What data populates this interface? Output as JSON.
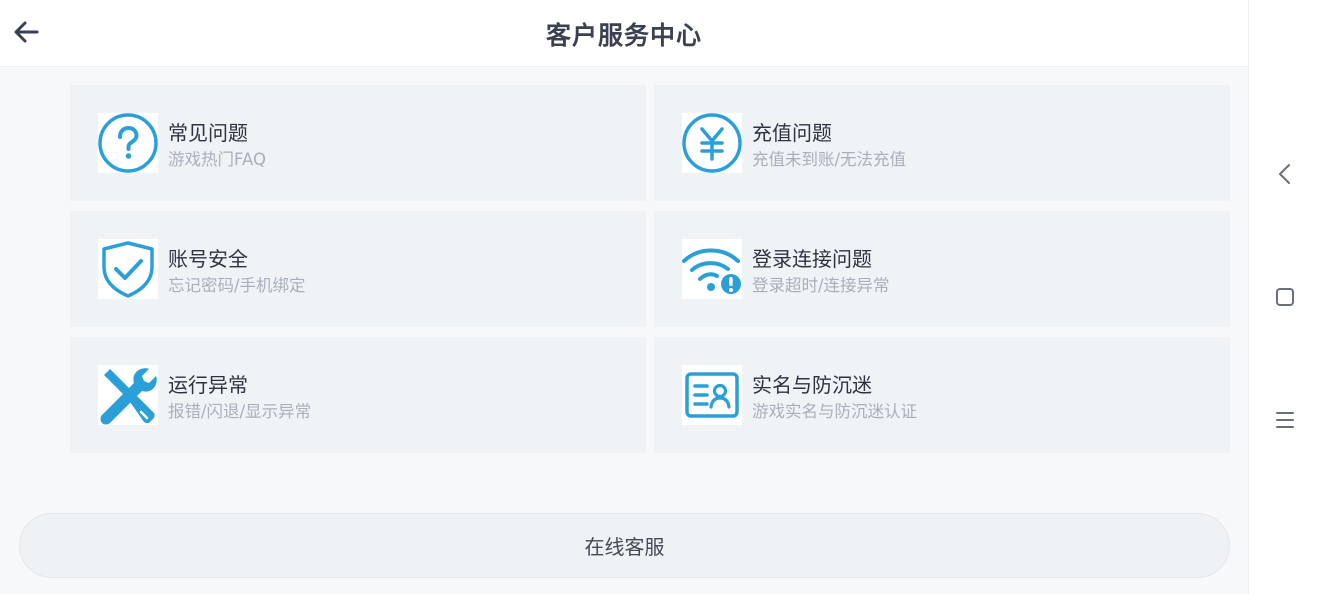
{
  "header": {
    "title": "客户服务中心",
    "back_icon": "arrow-left-icon"
  },
  "cards": [
    {
      "title": "常见问题",
      "subtitle": "游戏热门FAQ",
      "icon": "question-circle-icon"
    },
    {
      "title": "充值问题",
      "subtitle": "充值未到账/无法充值",
      "icon": "yen-circle-icon"
    },
    {
      "title": "账号安全",
      "subtitle": "忘记密码/手机绑定",
      "icon": "shield-check-icon"
    },
    {
      "title": "登录连接问题",
      "subtitle": "登录超时/连接异常",
      "icon": "wifi-alert-icon"
    },
    {
      "title": "运行异常",
      "subtitle": "报错/闪退/显示异常",
      "icon": "tools-icon"
    },
    {
      "title": "实名与防沉迷",
      "subtitle": "游戏实名与防沉迷认证",
      "icon": "id-card-icon"
    }
  ],
  "online_service": {
    "label": "在线客服"
  },
  "navbar": {
    "items": [
      "back-triangle-icon",
      "home-square-icon",
      "menu-lines-icon"
    ]
  },
  "colors": {
    "accent": "#2a9fd8",
    "title_text": "#3c4152",
    "subtitle_text": "#a9b0ba",
    "card_bg": "#eff3f6"
  }
}
